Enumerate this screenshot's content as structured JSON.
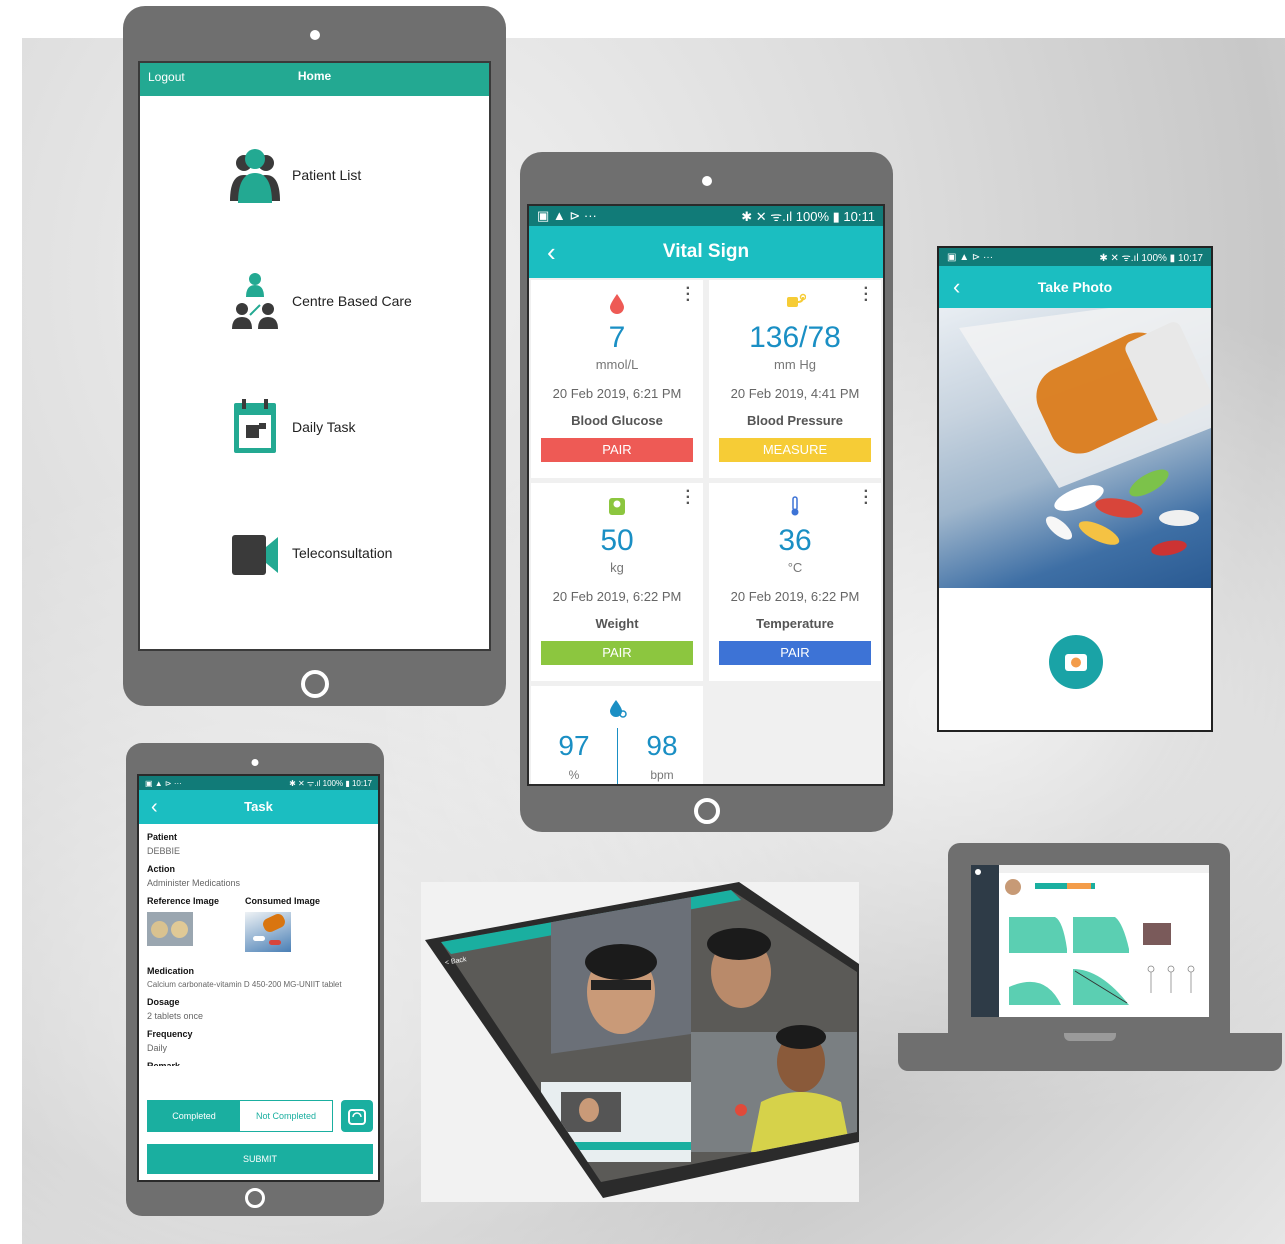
{
  "home": {
    "logout_label": "Logout",
    "title": "Home",
    "items": [
      {
        "label": "Patient List",
        "icon": "patients-icon"
      },
      {
        "label": "Centre Based Care",
        "icon": "centre-care-icon"
      },
      {
        "label": "Daily Task",
        "icon": "calendar-task-icon"
      },
      {
        "label": "Teleconsultation",
        "icon": "video-camera-icon"
      }
    ]
  },
  "vital": {
    "status_left": "▣ ▲ ⊳ ···",
    "status_right": "✱ ✕ ᯤ.ıl 100% ▮ 10:11",
    "title": "Vital Sign",
    "cards": [
      {
        "value": "7",
        "unit": "mmol/L",
        "time": "20 Feb 2019, 6:21 PM",
        "name": "Blood Glucose",
        "button": "PAIR",
        "color": "#ee5a55"
      },
      {
        "value": "136/78",
        "unit": "mm Hg",
        "time": "20 Feb 2019, 4:41 PM",
        "name": "Blood Pressure",
        "button": "MEASURE",
        "color": "#f6cc36"
      },
      {
        "value": "50",
        "unit": "kg",
        "time": "20 Feb 2019, 6:22 PM",
        "name": "Weight",
        "button": "PAIR",
        "color": "#8cc63f"
      },
      {
        "value": "36",
        "unit": "°C",
        "time": "20 Feb 2019, 6:22 PM",
        "name": "Temperature",
        "button": "PAIR",
        "color": "#3d73d6"
      }
    ],
    "spo2": {
      "value_left": "97",
      "unit_left": "%",
      "value_right": "98",
      "unit_right": "bpm"
    }
  },
  "photo": {
    "status_left": "▣ ▲ ⊳ ···",
    "status_right": "✱ ✕ ᯤ.ıl 100% ▮ 10:17",
    "title": "Take Photo"
  },
  "task": {
    "status_left": "▣ ▲ ⊳ ···",
    "status_right": "✱ ✕ ᯤ.ıl 100% ▮ 10:17",
    "title": "Task",
    "patient_label": "Patient",
    "patient_value": "DEBBIE",
    "action_label": "Action",
    "action_value": "Administer Medications",
    "ref_image_label": "Reference Image",
    "consumed_image_label": "Consumed Image",
    "medication_label": "Medication",
    "medication_value": "Calcium carbonate-vitamin D 450-200 MG-UNIIT tablet",
    "dosage_label": "Dosage",
    "dosage_value": "2 tablets once",
    "frequency_label": "Frequency",
    "frequency_value": "Daily",
    "remark_label": "Remark",
    "completed_label": "Completed",
    "not_completed_label": "Not Completed",
    "submit_label": "SUBMIT"
  },
  "tele": {
    "back_label": "< Back"
  },
  "colors": {
    "teal": "#1aafa0",
    "home_bar": "#23a992",
    "vital_status": "#117b78",
    "vital_bar": "#1bbec1",
    "value_blue": "#1a8fc4"
  }
}
